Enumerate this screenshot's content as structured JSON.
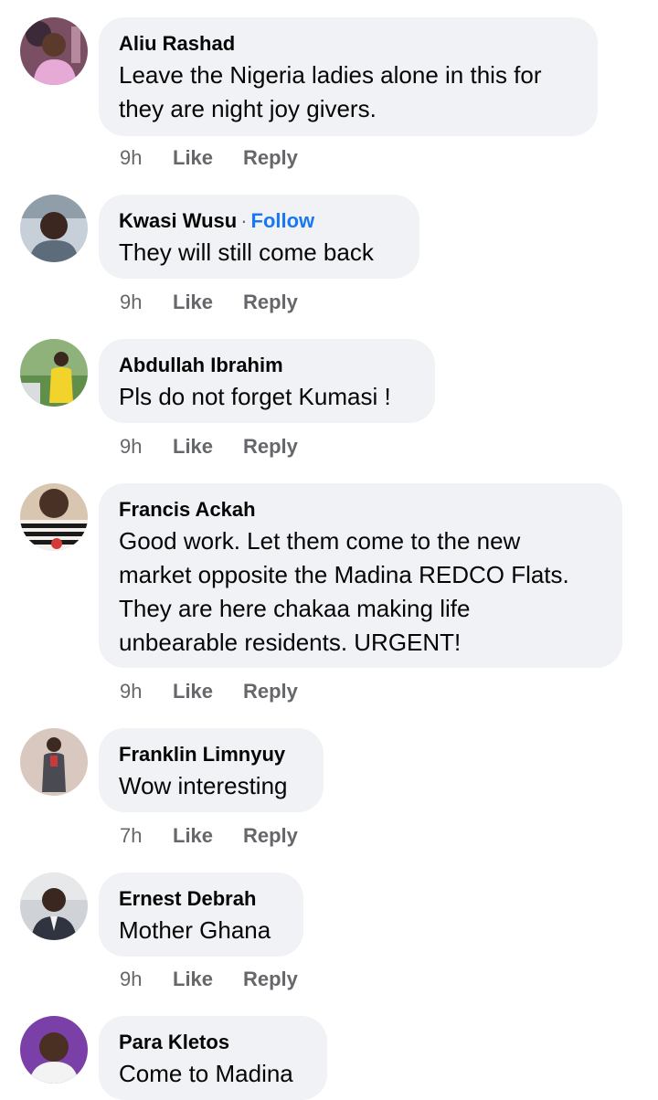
{
  "comments": [
    {
      "name": "Aliu Rashad",
      "text_lines": [
        "Leave the Nigeria ladies alone in this for",
        "they are night joy givers."
      ],
      "time": "9h",
      "like": "Like",
      "reply": "Reply",
      "avatar_icon": "user-avatar-pink-shirt"
    },
    {
      "name": "Kwasi Wusu",
      "follow_separator": "·",
      "follow": "Follow",
      "text_lines": [
        "They will still come back"
      ],
      "time": "9h",
      "like": "Like",
      "reply": "Reply",
      "avatar_icon": "user-avatar-car-selfie"
    },
    {
      "name": "Abdullah Ibrahim",
      "text_lines": [
        "Pls do not forget Kumasi !"
      ],
      "time": "9h",
      "like": "Like",
      "reply": "Reply",
      "avatar_icon": "user-avatar-yellow-shirt-outdoor"
    },
    {
      "name": "Francis Ackah",
      "text_lines": [
        "Good work. Let them come to the new",
        "market opposite the Madina REDCO Flats.",
        "They are here chakaa making life",
        "unbearable residents. URGENT!"
      ],
      "time": "9h",
      "like": "Like",
      "reply": "Reply",
      "avatar_icon": "user-avatar-striped-shirt"
    },
    {
      "name": "Franklin Limnyuy",
      "text_lines": [
        "Wow interesting"
      ],
      "time": "7h",
      "like": "Like",
      "reply": "Reply",
      "avatar_icon": "user-avatar-suit-standing"
    },
    {
      "name": "Ernest Debrah",
      "text_lines": [
        "Mother Ghana"
      ],
      "time": "9h",
      "like": "Like",
      "reply": "Reply",
      "avatar_icon": "user-avatar-suit-portrait"
    },
    {
      "name": "Para Kletos",
      "text_lines": [
        "Come to Madina"
      ],
      "avatar_icon": "user-avatar-purple-background"
    }
  ],
  "colors": {
    "bubble": "#f0f2f5",
    "name": "#050505",
    "meta": "#65676b",
    "follow": "#1877f2"
  }
}
